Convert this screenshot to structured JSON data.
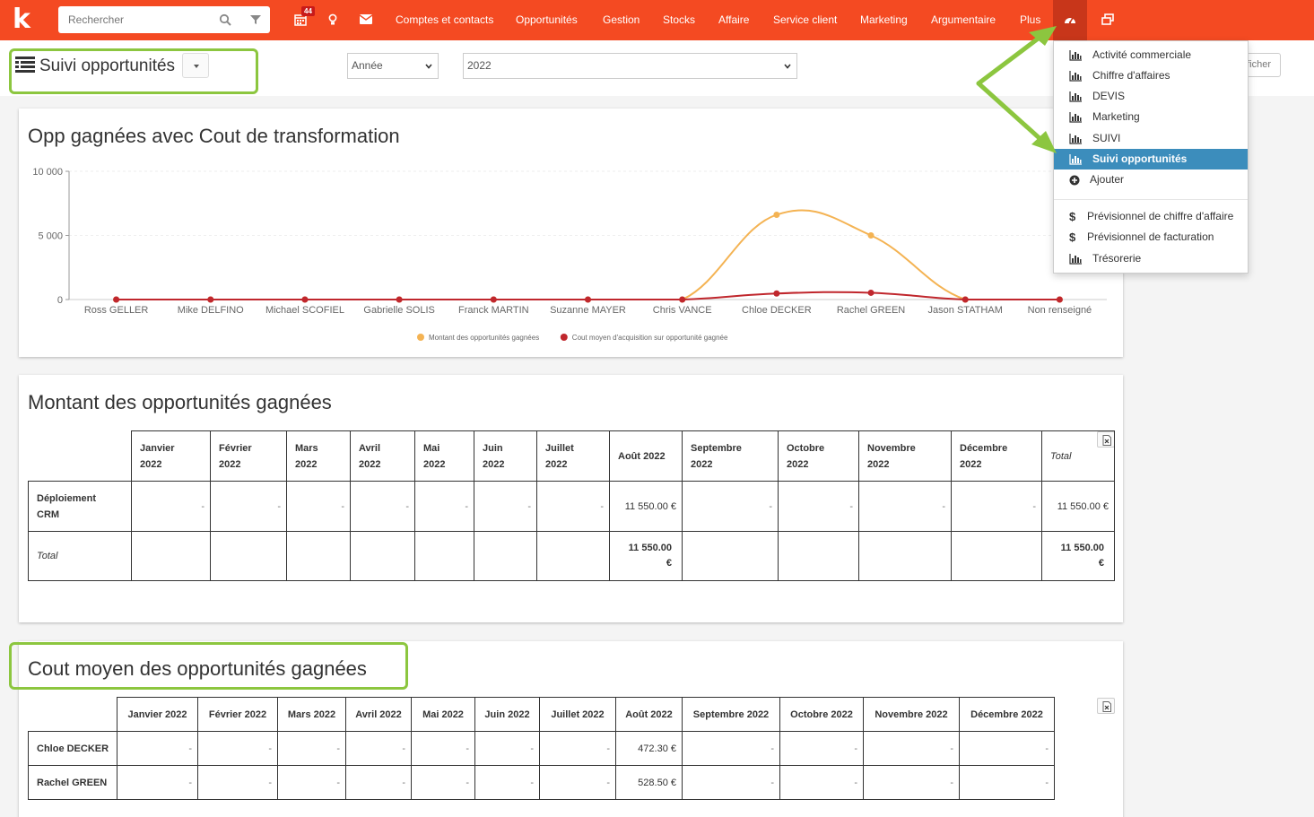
{
  "topbar": {
    "search_placeholder": "Rechercher",
    "badge": "44",
    "nav": [
      "Comptes et contacts",
      "Opportunités",
      "Gestion",
      "Stocks",
      "Affaire",
      "Service client",
      "Marketing",
      "Argumentaire",
      "Plus"
    ],
    "accent": "#f44a22"
  },
  "header": {
    "title": "Suivi opportunités",
    "period_select": "Année",
    "year_select": "2022",
    "show_button": "ficher"
  },
  "dropdown": {
    "items": [
      "Activité commerciale",
      "Chiffre d'affaires",
      "DEVIS",
      "Marketing",
      "SUIVI",
      "Suivi opportunités",
      "Ajouter"
    ],
    "extra_items": [
      "Prévisionnel de chiffre d'affaire",
      "Prévisionnel de facturation",
      "Trésorerie"
    ],
    "selected_color": "#3c8dbc"
  },
  "chart_card": {
    "title": "Opp gagnées avec Cout de transformation"
  },
  "chart_data": {
    "type": "line",
    "title": "Opp gagnées avec Cout de transformation",
    "categories": [
      "Ross GELLER",
      "Mike DELFINO",
      "Michael  SCOFIEL",
      "Gabrielle SOLIS",
      "Franck MARTIN",
      "Suzanne MAYER",
      "Chris VANCE",
      "Chloe DECKER",
      "Rachel GREEN",
      "Jason STATHAM",
      "Non renseigné"
    ],
    "series": [
      {
        "name": "Montant des opportunités gagnées",
        "color": "#f4b353",
        "values": [
          0,
          0,
          0,
          0,
          0,
          0,
          0,
          6610,
          5000,
          0,
          0
        ]
      },
      {
        "name": "Cout moyen d'acquisition sur opportunité gagnée",
        "color": "#c0272d",
        "values": [
          0,
          0,
          0,
          0,
          0,
          0,
          0,
          472.3,
          528.5,
          0,
          0
        ]
      }
    ],
    "yticks": [
      "10 000",
      "5 000",
      "0"
    ],
    "ylim": [
      0,
      10000
    ],
    "legend": "bottom"
  },
  "table1": {
    "title": "Montant des opportunités gagnées",
    "headers": [
      [
        "Janvier",
        "2022"
      ],
      [
        "Février",
        "2022"
      ],
      [
        "Mars",
        "2022"
      ],
      [
        "Avril",
        "2022"
      ],
      [
        "Mai",
        "2022"
      ],
      [
        "Juin",
        "2022"
      ],
      [
        "Juillet",
        "2022"
      ],
      [
        "Août 2022",
        ""
      ],
      [
        "Septembre",
        "2022"
      ],
      [
        "Octobre",
        "2022"
      ],
      [
        "Novembre",
        "2022"
      ],
      [
        "Décembre",
        "2022"
      ],
      [
        "Total",
        ""
      ]
    ],
    "rows": [
      {
        "label": [
          "Déploiement",
          "CRM"
        ],
        "values": [
          "-",
          "-",
          "-",
          "-",
          "-",
          "-",
          "-",
          "11 550.00 €",
          "-",
          "-",
          "-",
          "-",
          "11 550.00 €"
        ]
      }
    ],
    "total_label": "Total",
    "total_aug": [
      "11 550.00",
      "€"
    ],
    "total_total": [
      "11 550.00",
      "€"
    ]
  },
  "table2": {
    "title": "Cout moyen des opportunités gagnées",
    "headers": [
      "Janvier 2022",
      "Février 2022",
      "Mars 2022",
      "Avril 2022",
      "Mai 2022",
      "Juin 2022",
      "Juillet 2022",
      "Août 2022",
      "Septembre 2022",
      "Octobre 2022",
      "Novembre 2022",
      "Décembre 2022"
    ],
    "rows": [
      {
        "label": "Chloe DECKER",
        "values": [
          "-",
          "-",
          "-",
          "-",
          "-",
          "-",
          "-",
          "472.30 €",
          "-",
          "-",
          "-",
          "-"
        ]
      },
      {
        "label": "Rachel GREEN",
        "values": [
          "-",
          "-",
          "-",
          "-",
          "-",
          "-",
          "-",
          "528.50 €",
          "-",
          "-",
          "-",
          "-"
        ]
      }
    ]
  }
}
